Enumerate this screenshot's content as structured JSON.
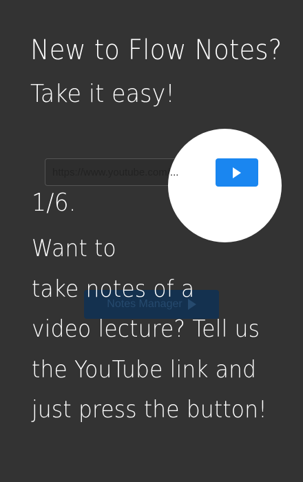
{
  "tutorial": {
    "title": "New to Flow Notes?",
    "subtitle": "Take it easy!",
    "step": "1/6.",
    "body_lines": [
      "Want to",
      "take notes of a",
      "video lecture? Tell us",
      "the YouTube link and",
      "just press the button!"
    ]
  },
  "url_input": {
    "value": "https://www.youtube.com/..."
  },
  "notes_manager_button": {
    "label": "Notes Manager"
  },
  "colors": {
    "background": "#333333",
    "accent": "#1a86f0",
    "text": "#ffffff"
  }
}
